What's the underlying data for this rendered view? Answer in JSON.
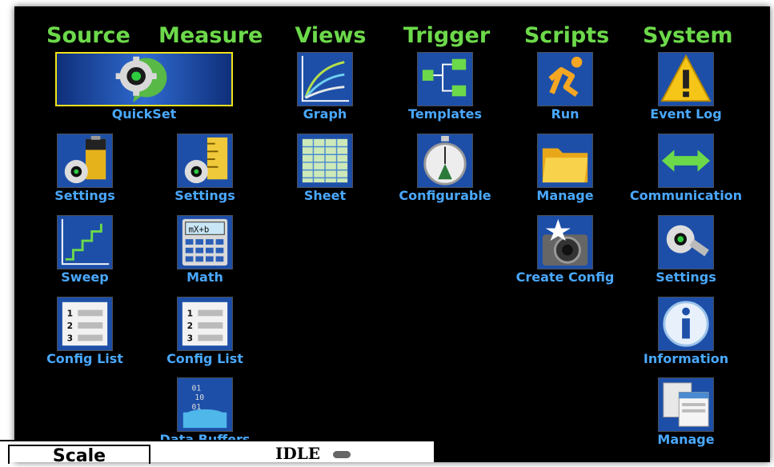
{
  "menu": {
    "columns": [
      {
        "header": "Source"
      },
      {
        "header": "Measure"
      },
      {
        "header": "Views"
      },
      {
        "header": "Trigger"
      },
      {
        "header": "Scripts"
      },
      {
        "header": "System"
      }
    ],
    "items": {
      "quickset": {
        "label": "QuickSet",
        "icon": "quickset-gear-icon"
      },
      "source_settings": {
        "label": "Settings",
        "icon": "battery-gear-icon"
      },
      "source_sweep": {
        "label": "Sweep",
        "icon": "staircase-sweep-icon"
      },
      "source_config_list": {
        "label": "Config List",
        "icon": "numbered-list-icon"
      },
      "measure_settings": {
        "label": "Settings",
        "icon": "ruler-gear-icon"
      },
      "measure_math": {
        "label": "Math",
        "icon": "calculator-icon"
      },
      "measure_config_list": {
        "label": "Config List",
        "icon": "numbered-list-icon"
      },
      "measure_data_buffers": {
        "label": "Data Buffers",
        "icon": "data-buffer-icon"
      },
      "views_graph": {
        "label": "Graph",
        "icon": "graph-curves-icon"
      },
      "views_sheet": {
        "label": "Sheet",
        "icon": "spreadsheet-icon"
      },
      "trigger_templates": {
        "label": "Templates",
        "icon": "flow-template-icon"
      },
      "trigger_configurable": {
        "label": "Configurable",
        "icon": "stopwatch-icon"
      },
      "scripts_run": {
        "label": "Run",
        "icon": "running-person-icon"
      },
      "scripts_manage": {
        "label": "Manage",
        "icon": "folder-icon"
      },
      "scripts_create_config": {
        "label": "Create Config",
        "icon": "camera-icon"
      },
      "system_event_log": {
        "label": "Event Log",
        "icon": "warning-icon"
      },
      "system_communication": {
        "label": "Communication",
        "icon": "double-arrow-icon"
      },
      "system_settings": {
        "label": "Settings",
        "icon": "gear-wrench-icon"
      },
      "system_information": {
        "label": "Information",
        "icon": "info-icon"
      },
      "system_manage": {
        "label": "Manage",
        "icon": "windows-stack-icon"
      }
    }
  },
  "status_bar": {
    "tab_label": "Scale",
    "state_text": "IDLE"
  },
  "colors": {
    "header_green": "#6cd94a",
    "label_blue": "#4aa8ff",
    "selection_yellow": "#f2e21b",
    "background": "#000000"
  }
}
